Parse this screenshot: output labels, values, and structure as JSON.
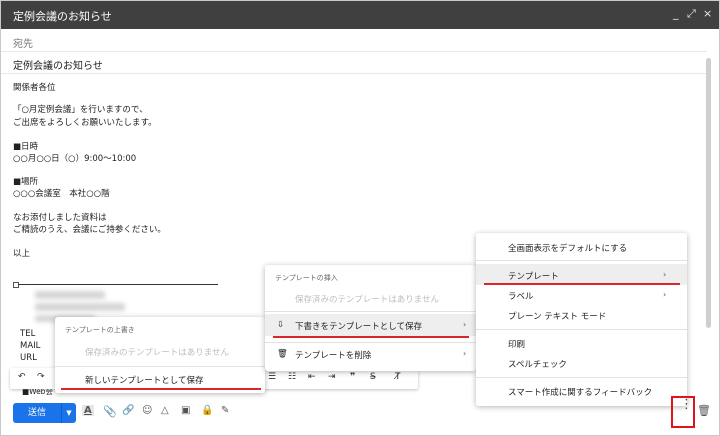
{
  "window": {
    "title": "定例会議のお知らせ",
    "controls": [
      "_",
      "⤢",
      "×"
    ]
  },
  "fields": {
    "to_label": "宛先",
    "subject": "定例会議のお知らせ"
  },
  "body": {
    "lines": [
      "関係者各位",
      "「○月定例会議」を行いますので、",
      "ご出席をよろしくお願いいたします。",
      "■日時",
      "○○月○○日（○）9:00〜10:00",
      "■場所",
      "○○○会議室　本社○○階",
      "なお添付しました資料は",
      "ご精読のうえ、会議にご持参ください。",
      "以上"
    ],
    "signature": {
      "tel": "TEL",
      "mail": "MAIL",
      "url": "URL",
      "web": "■Web会"
    }
  },
  "main_menu": {
    "items": [
      "全画面表示をデフォルトにする",
      "テンプレート",
      "ラベル",
      "プレーン テキスト モード",
      "印刷",
      "スペルチェック",
      "スマート作成に関するフィードバック"
    ]
  },
  "template_menu": {
    "insert_header": "テンプレートの挿入",
    "no_templates": "保存済みのテンプレートはありません",
    "save_draft": "下書きをテンプレートとして保存",
    "delete": "テンプレートを削除"
  },
  "overwrite_menu": {
    "header": "テンプレートの上書き",
    "no_templates": "保存済みのテンプレートはありません",
    "save_new": "新しいテンプレートとして保存"
  },
  "toolbar": {
    "send_label": "送信"
  },
  "colors": {
    "titlebar": "#404040",
    "send": "#1a73e8",
    "highlight": "#d8262b"
  }
}
